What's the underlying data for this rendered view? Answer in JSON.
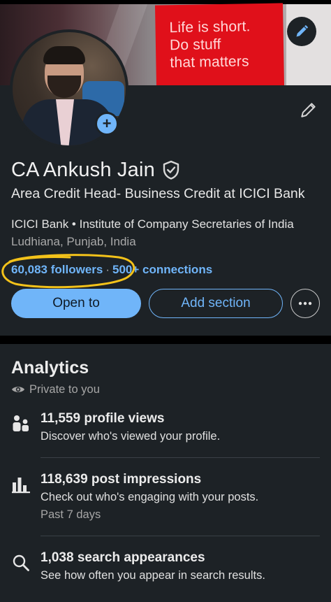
{
  "banner": {
    "slogan_line1": "Life is short.",
    "slogan_line2": "Do stuff",
    "slogan_line3": "that matters",
    "card_color": "#e0101a"
  },
  "profile": {
    "name": "CA Ankush Jain",
    "headline": "Area Credit Head- Business Credit at ICICI Bank",
    "company_education": "ICICI Bank • Institute of Company Secretaries of India",
    "location": "Ludhiana, Punjab, India",
    "followers": "60,083 followers",
    "separator": "·",
    "connections": "500+ connections"
  },
  "actions": {
    "open_to": "Open to",
    "add_section": "Add section"
  },
  "analytics": {
    "title": "Analytics",
    "visibility": "Private to you",
    "items": [
      {
        "icon": "people-icon",
        "title": "11,559 profile views",
        "description": "Discover who's viewed your profile."
      },
      {
        "icon": "bar-chart-icon",
        "title": "118,639 post impressions",
        "description": "Check out who's engaging with your posts.",
        "subtitle": "Past 7 days"
      },
      {
        "icon": "search-icon",
        "title": "1,038 search appearances",
        "description": "See how often you appear in search results."
      }
    ]
  },
  "colors": {
    "accent": "#70b5f9",
    "card_bg": "#1d2226",
    "annotation_circle": "#f3c21a"
  }
}
